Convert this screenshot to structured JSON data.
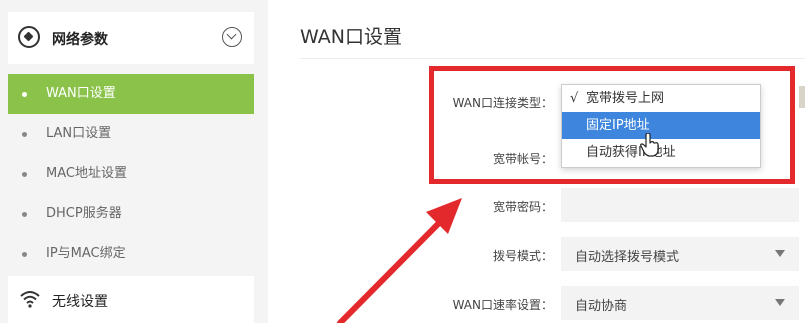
{
  "sidebar": {
    "header": {
      "title": "网络参数",
      "icon": "network-params-icon",
      "toggle_icon": "chevron-circle-icon"
    },
    "items": [
      {
        "label": "WAN口设置",
        "active": true
      },
      {
        "label": "LAN口设置",
        "active": false
      },
      {
        "label": "MAC地址设置",
        "active": false
      },
      {
        "label": "DHCP服务器",
        "active": false
      },
      {
        "label": "IP与MAC绑定",
        "active": false
      }
    ],
    "footer": {
      "title": "无线设置",
      "icon": "wifi-icon"
    }
  },
  "main": {
    "page_title": "WAN口设置",
    "form": {
      "wan_type_label": "WAN口连接类型：",
      "account_label": "宽带帐号：",
      "password_label": "宽带密码：",
      "password_value": "",
      "dial_mode_label": "拨号模式：",
      "dial_mode_value": "自动选择拨号模式",
      "speed_label": "WAN口速率设置：",
      "speed_value": "自动协商"
    },
    "dropdown": {
      "options": [
        {
          "label": "宽带拨号上网",
          "checked": true,
          "check_mark": "√"
        },
        {
          "label": "固定IP地址",
          "hover": true
        },
        {
          "label": "自动获得IP地址"
        }
      ]
    }
  },
  "colors": {
    "active_green": "#8bc34a",
    "highlight_blue": "#3e86dd",
    "annotation_red": "#e4292c"
  }
}
